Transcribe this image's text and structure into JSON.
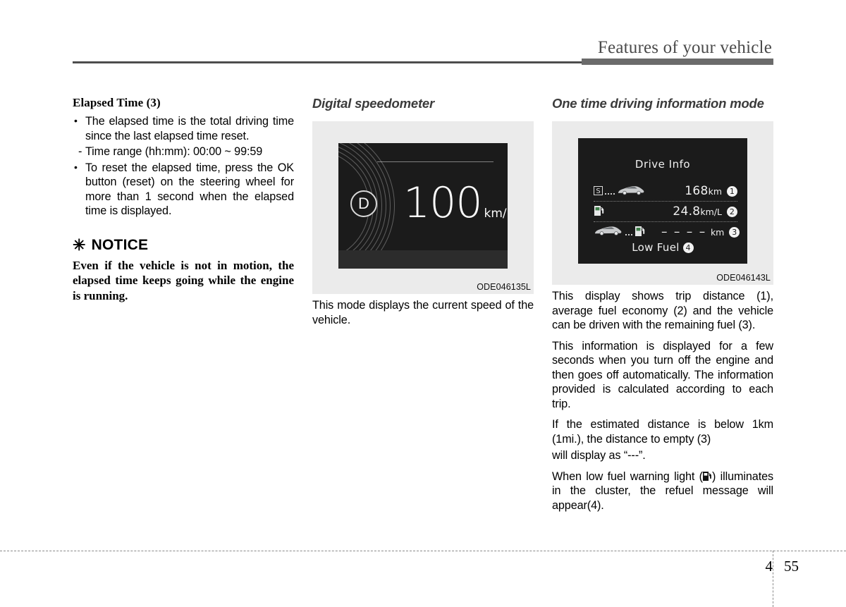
{
  "header": {
    "title": "Features of your vehicle"
  },
  "footer": {
    "chapter": "4",
    "page": "55"
  },
  "left_column": {
    "heading": "Elapsed Time (3)",
    "bullets": [
      {
        "marker": "•",
        "text": "The elapsed time is the total driving time since the last elapsed time reset."
      },
      {
        "marker": "•",
        "text": "To reset the elapsed time, press the OK button (reset) on the steering wheel for more than 1 second when the elapsed time is displayed."
      }
    ],
    "sub_item": {
      "marker": "-",
      "text": "Time range (hh:mm): 00:00 ~ 99:59"
    },
    "notice": {
      "asterisk": "✳",
      "title": "NOTICE",
      "body": "Even if the vehicle is not in motion, the elapsed time keeps going while the engine is running."
    }
  },
  "middle_column": {
    "heading": "Digital speedometer",
    "figure": {
      "image_id": "ODE046135L",
      "cluster": {
        "gear_indicator": "D",
        "speed_value": "100",
        "speed_unit": "km/h"
      }
    },
    "caption": "This mode displays the current speed of the vehicle."
  },
  "right_column": {
    "heading": "One time driving information mode",
    "figure": {
      "image_id": "ODE046143L",
      "cluster": {
        "title": "Drive Info",
        "rows": [
          {
            "icons": [
              "trip-start-icon",
              "dots-icon",
              "car-icon"
            ],
            "value": "168",
            "unit": "km",
            "index": "1"
          },
          {
            "icons": [
              "fuel-pump-icon"
            ],
            "value": "24.8",
            "unit": "km/L",
            "index": "2"
          },
          {
            "icons": [
              "car-icon",
              "dots-icon",
              "fuel-pump-icon"
            ],
            "value": "– – – –",
            "unit": "km",
            "index": "3"
          }
        ],
        "low_fuel_label": "Low Fuel",
        "low_fuel_index": "4"
      }
    },
    "paragraphs": [
      "This display shows trip distance (1), average fuel economy (2) and the vehicle can be driven with the remaining fuel (3).",
      "This information is displayed for a few seconds when you turn off the engine and then goes off automatically. The information provided is calculated according to each trip.",
      "If the estimated distance is below 1km (1mi.), the distance to empty (3)"
    ],
    "paragraph_display_as": "will display as “---”.",
    "low_fuel_sentence_before": "When low fuel warning light (",
    "low_fuel_sentence_after": ") illuminates in the cluster, the refuel message will appear(4)."
  },
  "colors": {
    "cluster_background": "#1b1b1b",
    "figure_background": "#ebebeb",
    "header_rule": "#6b6b6b",
    "heading_italic": "#3b3b3b"
  }
}
